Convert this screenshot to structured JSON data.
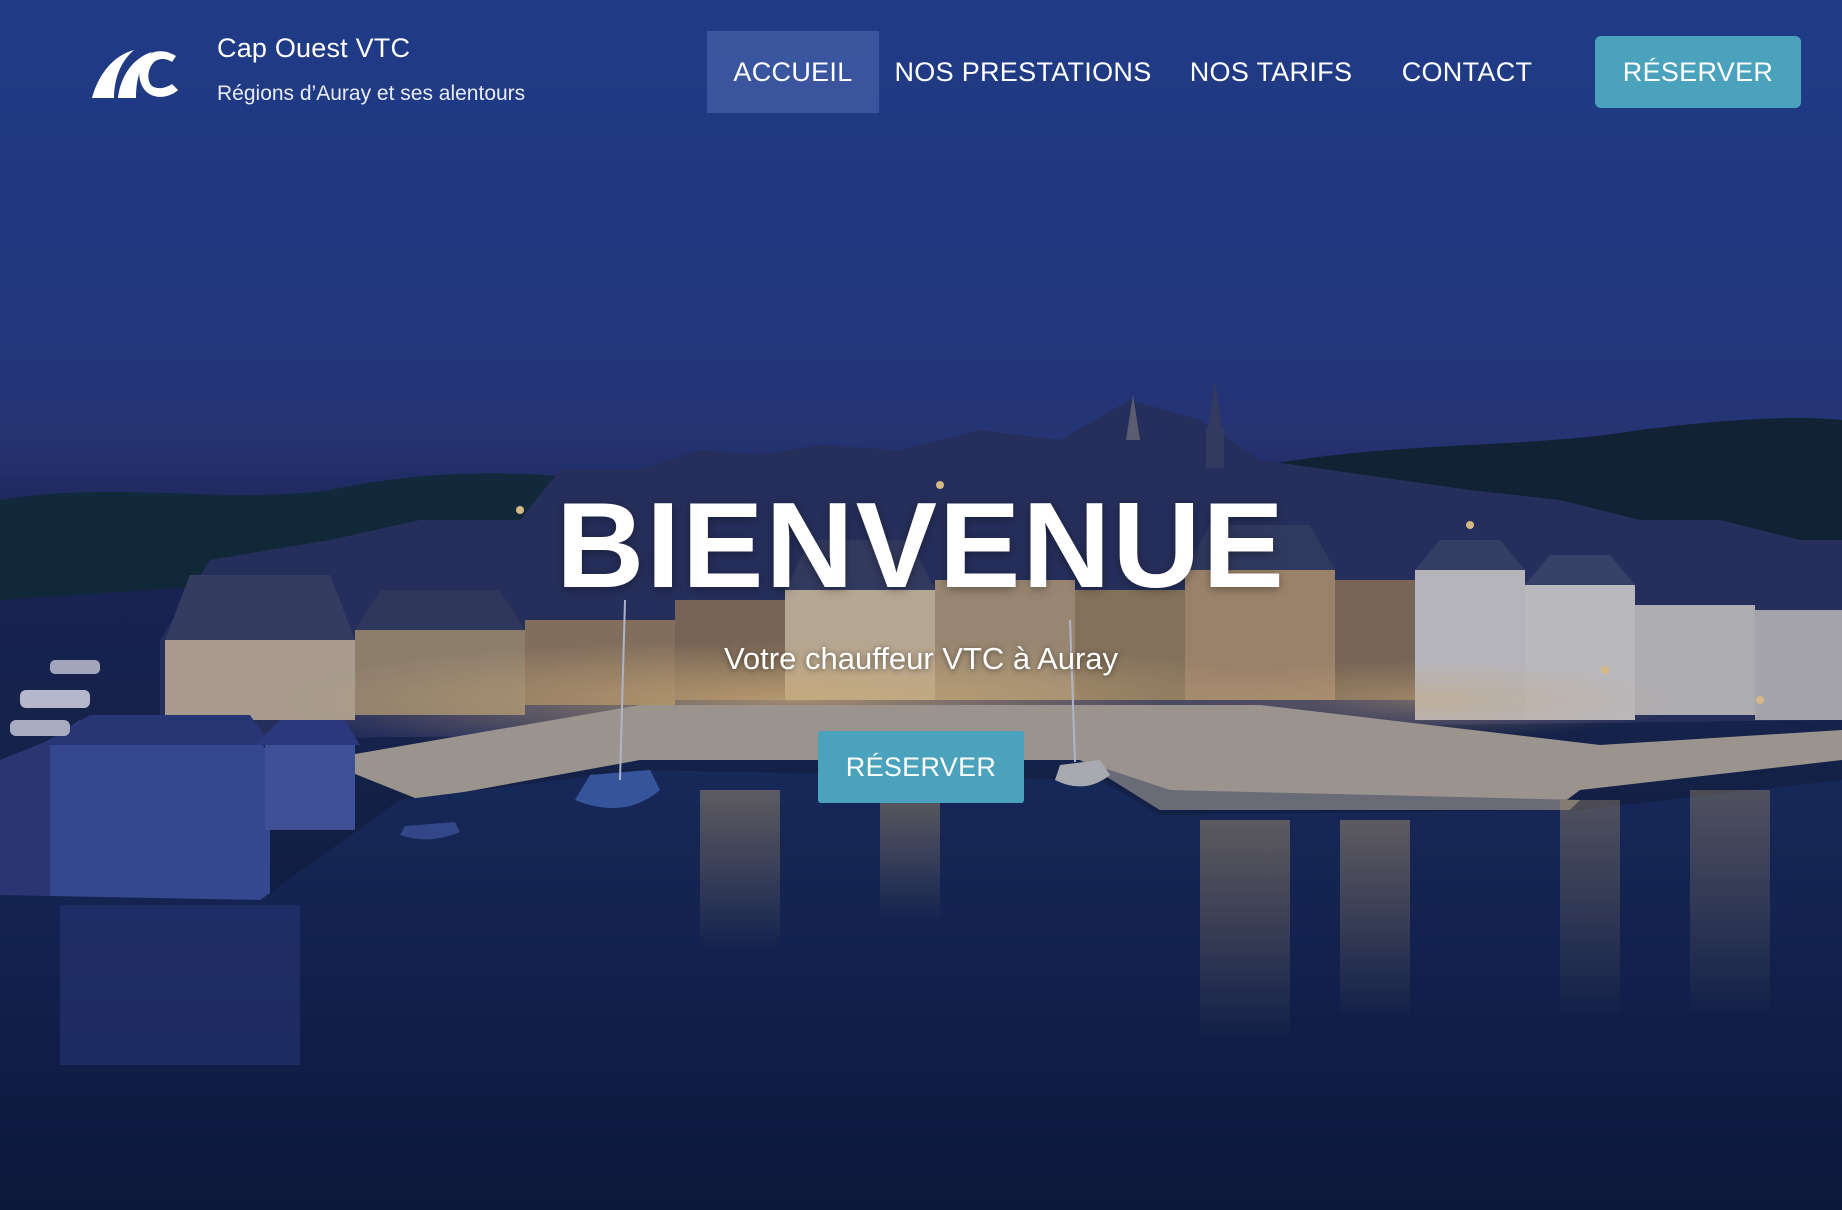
{
  "brand": {
    "name": "Cap Ouest VTC",
    "tagline": "Régions d’Auray et ses alentours",
    "logo_icon": "cap-ouest-logo-icon"
  },
  "nav": {
    "items": [
      {
        "label": "ACCUEIL",
        "active": true
      },
      {
        "label": "NOS PRESTATIONS",
        "active": false
      },
      {
        "label": "NOS TARIFS",
        "active": false
      },
      {
        "label": "CONTACT",
        "active": false
      }
    ],
    "cta_label": "RÉSERVER"
  },
  "hero": {
    "title": "BIENVENUE",
    "subtitle": "Votre chauffeur VTC à Auray",
    "cta_label": "RÉSERVER"
  },
  "colors": {
    "accent": "#4aa2bd",
    "sky": "#23418c",
    "active_nav_bg": "#5a78be"
  }
}
